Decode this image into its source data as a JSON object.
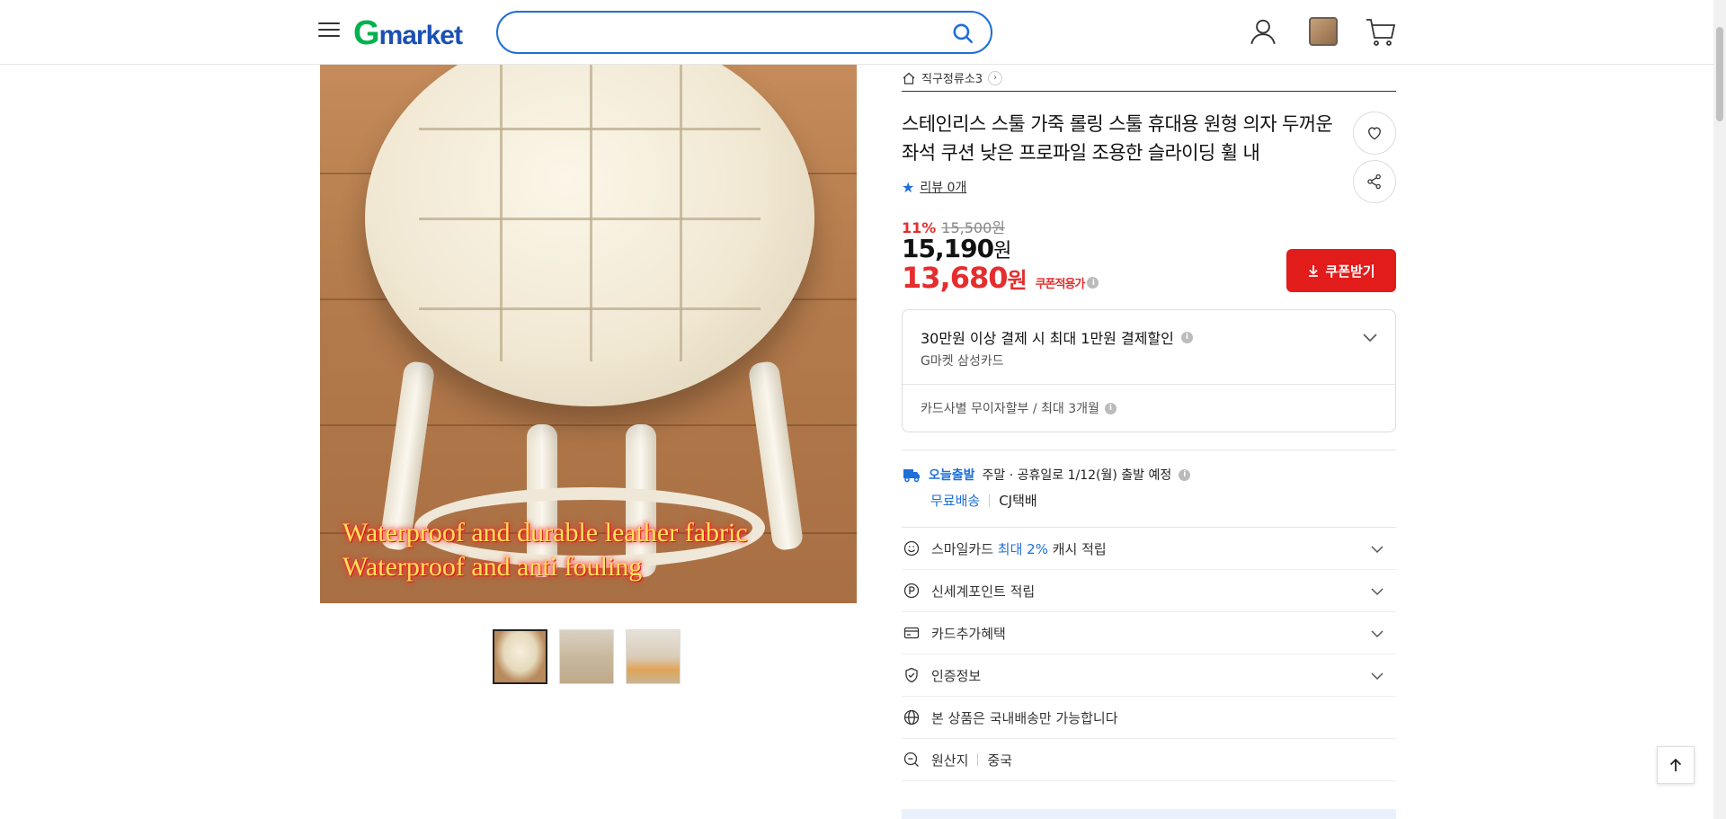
{
  "header": {
    "logo_g": "G",
    "logo_rest": "market",
    "search_placeholder": "",
    "icons": [
      "menu-icon",
      "search-icon",
      "user-icon",
      "recent-view-icon",
      "cart-icon"
    ]
  },
  "product_images": {
    "caption_line1": "Waterproof and durable leather fabric",
    "caption_line2": "Waterproof and anti fouling",
    "thumbnails": 3,
    "selected_thumbnail": 1
  },
  "product": {
    "breadcrumb": "직구정류소3",
    "title": "스테인리스 스툴 가죽 롤링 스툴 휴대용 원형 의자 두꺼운 좌석 쿠션 낮은 프로파일 조용한 슬라이딩 휠 내",
    "review_label": "리뷰 0개",
    "discount_rate": "11%",
    "original_price": "15,500원",
    "sale_price_num": "15,190",
    "sale_price_unit": "원",
    "coupon_price_num": "13,680",
    "coupon_price_unit": "원",
    "coupon_applied_label": "쿠폰적용가",
    "coupon_button": "쿠폰받기"
  },
  "card_promo": {
    "title": "30만원 이상 결제 시 최대 1만원 결제할인",
    "card": "G마켓 삼성카드",
    "installment": "카드사별 무이자할부 / 최대 3개월"
  },
  "shipping": {
    "today_label": "오늘출발",
    "notice": "주말 · 공휴일로 1/12(월) 출발 예정",
    "fee": "무료배송",
    "carrier": "CJ택배"
  },
  "benefits": {
    "smile_prefix": "스마일카드",
    "smile_highlight": "최대 2%",
    "smile_suffix": "캐시 적립",
    "shinsegae": "신세계포인트 적립",
    "card_extra": "카드추가혜택",
    "certification": "인증정보",
    "domestic": "본 상품은 국내배송만 가능합니다",
    "origin_label": "원산지",
    "origin_value": "중국"
  },
  "colors": {
    "brand_green": "#00b14f",
    "brand_blue": "#1b50b3",
    "accent_red": "#e21b1b",
    "link_blue": "#1e6fd9"
  }
}
